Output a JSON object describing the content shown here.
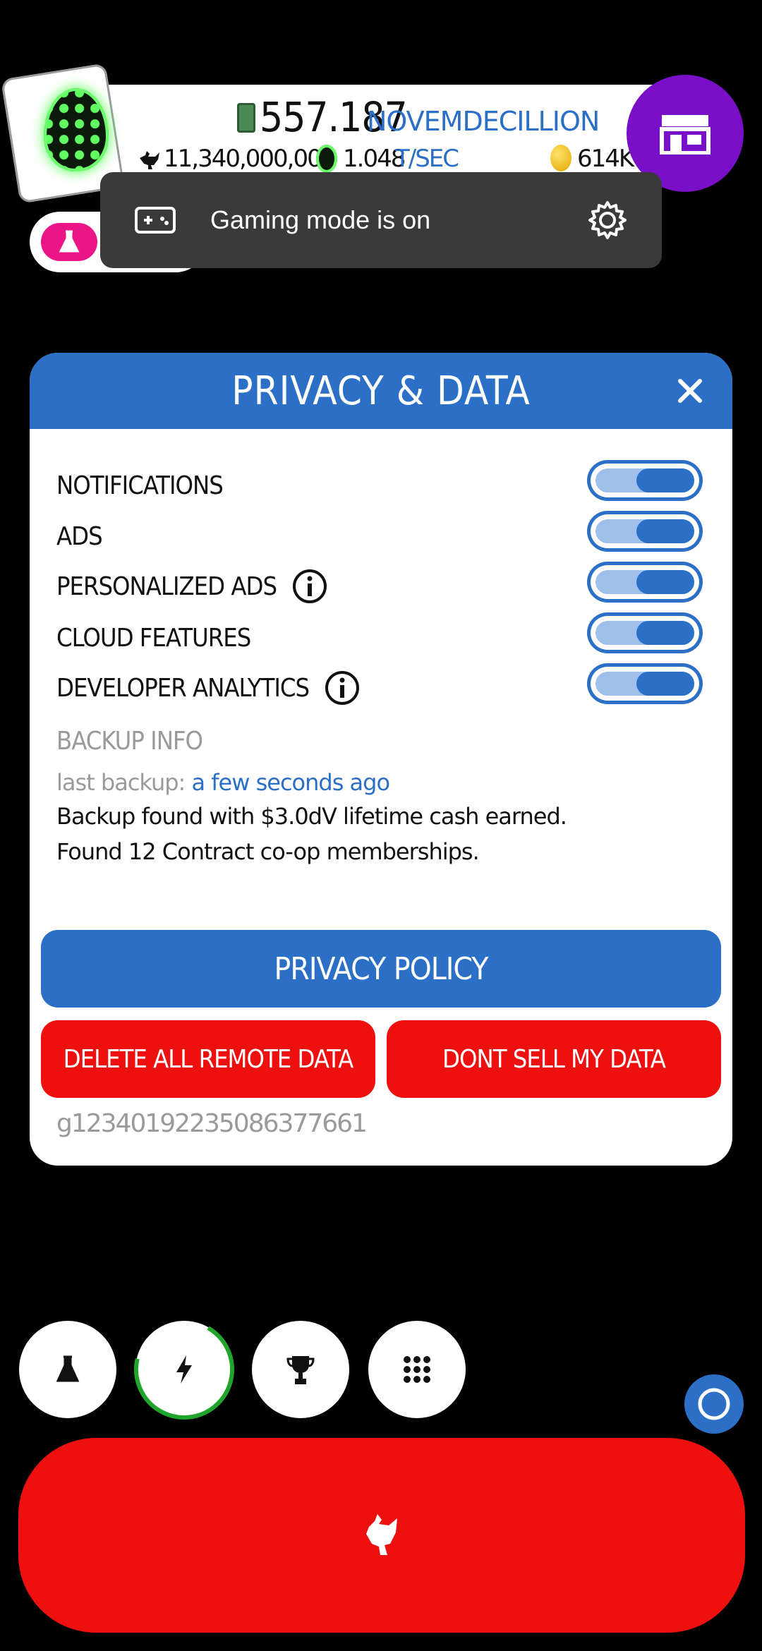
{
  "hud": {
    "cash_value": "557.187",
    "cash_unit": "NOVEMDECILLION",
    "chickens": "11,340,000,000",
    "egg_rate_value": "1.048",
    "egg_rate_unit": "T/SEC",
    "golden_eggs": "614K"
  },
  "toast": {
    "text": "Gaming mode is on"
  },
  "dialog": {
    "title": "PRIVACY & DATA",
    "settings": [
      {
        "label": "NOTIFICATIONS",
        "on": true
      },
      {
        "label": "ADS",
        "on": true
      },
      {
        "label": "PERSONALIZED ADS",
        "on": true
      },
      {
        "label": "CLOUD FEATURES",
        "on": true
      },
      {
        "label": "DEVELOPER ANALYTICS",
        "on": true
      }
    ],
    "backup": {
      "title": "BACKUP INFO",
      "last_backup_label": "last backup:",
      "last_backup_value": "a few seconds ago",
      "line1": "Backup found with $3.0dV lifetime cash earned.",
      "line2": "Found 12 Contract co-op memberships."
    },
    "privacy_policy_label": "PRIVACY POLICY",
    "delete_label": "DELETE ALL REMOTE DATA",
    "dont_sell_label": "DONT SELL MY DATA",
    "user_id": "g12340192235086377661"
  },
  "colors": {
    "blue": "#2b6fc7",
    "red": "#ee0f0f",
    "purple": "#7a0fc8",
    "pink": "#ec1587"
  }
}
